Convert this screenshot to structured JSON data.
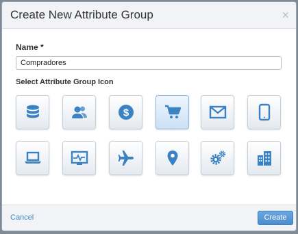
{
  "dialog": {
    "title": "Create New Attribute Group",
    "close_glyph": "×"
  },
  "form": {
    "name_label": "Name *",
    "name_value": "Compradores",
    "icon_label": "Select Attribute Group Icon"
  },
  "icon_color": "#3a82c4",
  "icons": [
    {
      "name": "database-icon",
      "selected": false
    },
    {
      "name": "users-icon",
      "selected": false
    },
    {
      "name": "dollar-icon",
      "selected": false
    },
    {
      "name": "shopping-cart-icon",
      "selected": true
    },
    {
      "name": "envelope-icon",
      "selected": false
    },
    {
      "name": "tablet-icon",
      "selected": false
    },
    {
      "name": "laptop-icon",
      "selected": false
    },
    {
      "name": "monitor-pulse-icon",
      "selected": false
    },
    {
      "name": "airplane-icon",
      "selected": false
    },
    {
      "name": "map-pin-icon",
      "selected": false
    },
    {
      "name": "gears-icon",
      "selected": false
    },
    {
      "name": "buildings-icon",
      "selected": false
    }
  ],
  "footer": {
    "cancel_label": "Cancel",
    "create_label": "Create"
  }
}
